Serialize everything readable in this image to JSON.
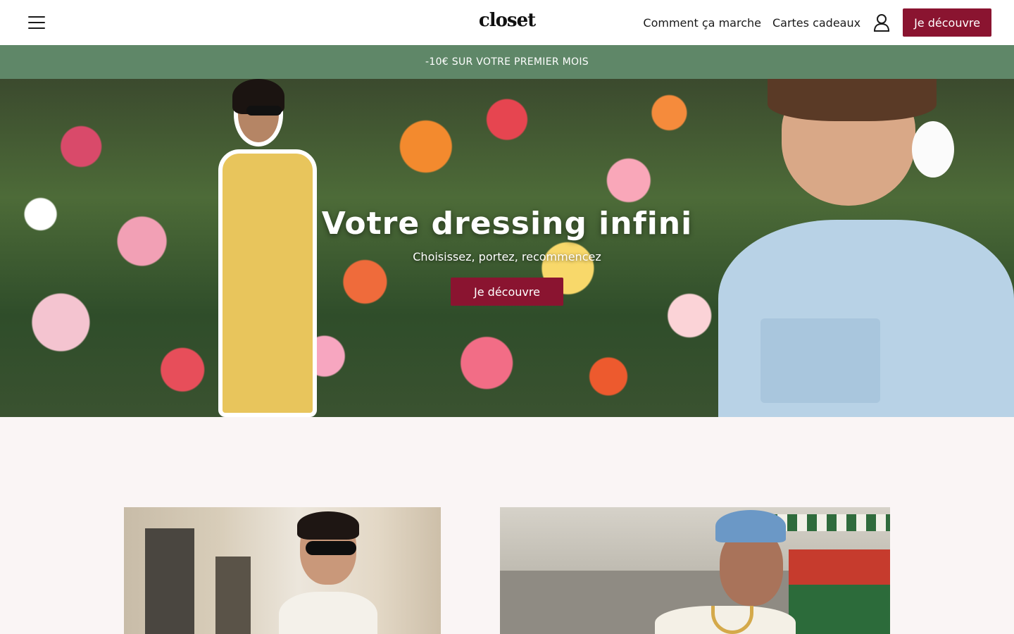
{
  "header": {
    "logo": "closet",
    "nav": {
      "how_it_works": "Comment ça marche",
      "gift_cards": "Cartes cadeaux",
      "cta": "Je découvre"
    }
  },
  "promo": {
    "text": "-10€ SUR VOTRE PREMIER MOIS"
  },
  "hero": {
    "title": "Votre dressing infini",
    "subtitle": "Choisissez, portez, recommencez",
    "cta": "Je découvre"
  },
  "icons": {
    "menu": "hamburger-menu-icon",
    "account": "user-icon"
  },
  "colors": {
    "brand": "#8a1430",
    "promo_bg": "#5f8768",
    "page_bg": "#faf5f5"
  }
}
